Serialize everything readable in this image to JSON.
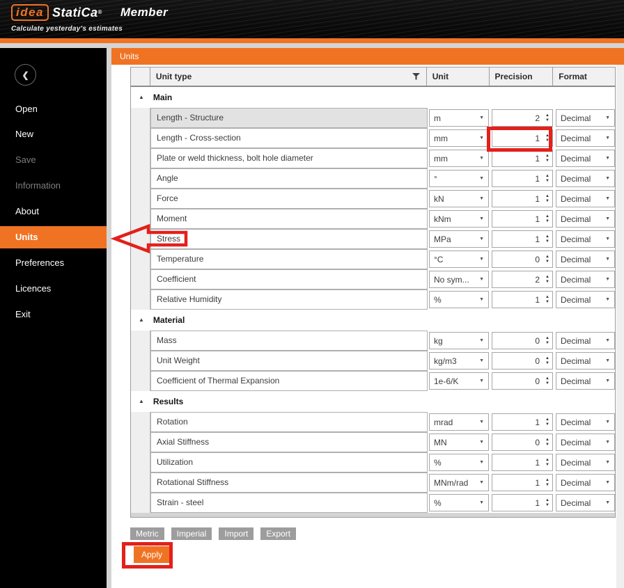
{
  "colors": {
    "brand_orange": "#f07323",
    "annotation_red": "#e3201b",
    "preset_button_gray": "#9d9d9d",
    "sidebar_black": "#000000",
    "selected_row_gray": "#e2e2e2"
  },
  "header": {
    "logo_idea": "idea",
    "logo_statica": "StatiCa",
    "registered_mark": "®",
    "product": "Member",
    "tagline": "Calculate yesterday's estimates"
  },
  "sidebar": {
    "back_icon": "❮",
    "items": [
      {
        "label": "Open",
        "state": "normal"
      },
      {
        "label": "New",
        "state": "normal"
      },
      {
        "label": "Save",
        "state": "disabled"
      },
      {
        "label": "Information",
        "state": "disabled"
      },
      {
        "label": "About",
        "state": "normal"
      },
      {
        "label": "Units",
        "state": "active"
      },
      {
        "label": "Preferences",
        "state": "normal"
      },
      {
        "label": "Licences",
        "state": "normal"
      },
      {
        "label": "Exit",
        "state": "normal"
      }
    ]
  },
  "panel": {
    "title": "Units"
  },
  "table": {
    "headers": {
      "unit_type": "Unit type",
      "unit": "Unit",
      "precision": "Precision",
      "format": "Format"
    },
    "collapse_icon": "▲",
    "dropdown_icon": "▼",
    "spinner_up_icon": "▲",
    "spinner_down_icon": "▼",
    "sections": [
      {
        "name": "Main",
        "rows": [
          {
            "unit_type": "Length - Structure",
            "unit": "m",
            "precision": "2",
            "format": "Decimal",
            "selected": true
          },
          {
            "unit_type": "Length - Cross-section",
            "unit": "mm",
            "precision": "1",
            "format": "Decimal"
          },
          {
            "unit_type": "Plate or weld thickness, bolt hole diameter",
            "unit": "mm",
            "precision": "1",
            "format": "Decimal"
          },
          {
            "unit_type": "Angle",
            "unit": "°",
            "precision": "1",
            "format": "Decimal"
          },
          {
            "unit_type": "Force",
            "unit": "kN",
            "precision": "1",
            "format": "Decimal"
          },
          {
            "unit_type": "Moment",
            "unit": "kNm",
            "precision": "1",
            "format": "Decimal"
          },
          {
            "unit_type": "Stress",
            "unit": "MPa",
            "precision": "1",
            "format": "Decimal"
          },
          {
            "unit_type": "Temperature",
            "unit": "°C",
            "precision": "0",
            "format": "Decimal"
          },
          {
            "unit_type": "Coefficient",
            "unit": "No sym...",
            "precision": "2",
            "format": "Decimal"
          },
          {
            "unit_type": "Relative Humidity",
            "unit": "%",
            "precision": "1",
            "format": "Decimal"
          }
        ]
      },
      {
        "name": "Material",
        "rows": [
          {
            "unit_type": "Mass",
            "unit": "kg",
            "precision": "0",
            "format": "Decimal"
          },
          {
            "unit_type": "Unit Weight",
            "unit": "kg/m3",
            "precision": "0",
            "format": "Decimal"
          },
          {
            "unit_type": "Coefficient of Thermal Expansion",
            "unit": "1e-6/K",
            "precision": "0",
            "format": "Decimal"
          }
        ]
      },
      {
        "name": "Results",
        "rows": [
          {
            "unit_type": "Rotation",
            "unit": "mrad",
            "precision": "1",
            "format": "Decimal"
          },
          {
            "unit_type": "Axial Stiffness",
            "unit": "MN",
            "precision": "0",
            "format": "Decimal"
          },
          {
            "unit_type": "Utilization",
            "unit": "%",
            "precision": "1",
            "format": "Decimal"
          },
          {
            "unit_type": "Rotational Stiffness",
            "unit": "MNm/rad",
            "precision": "1",
            "format": "Decimal"
          },
          {
            "unit_type": "Strain - steel",
            "unit": "%",
            "precision": "1",
            "format": "Decimal"
          }
        ]
      }
    ]
  },
  "buttons": {
    "presets": [
      "Metric",
      "Imperial",
      "Import",
      "Export"
    ],
    "apply": "Apply"
  }
}
